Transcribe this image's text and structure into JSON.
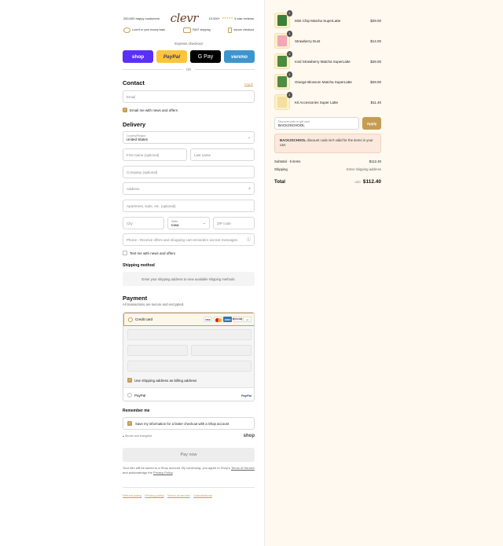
{
  "trust": {
    "customers": "250,000 happy customers",
    "brand": "clevr",
    "reviews_count": "10,000+",
    "stars": "★★★★★",
    "reviews_label": "5 star reviews",
    "badge_money_back": "Love it or your money back",
    "badge_shipping": "FAST shipping",
    "badge_secure": "secure checkout"
  },
  "express": {
    "label": "Express checkout",
    "shop": "shop",
    "paypal": "PayPal",
    "gpay": "G Pay",
    "venmo": "venmo",
    "or": "OR"
  },
  "contact": {
    "title": "Contact",
    "login": "Log in",
    "email_placeholder": "Email",
    "email_news": "Email me with news and offers"
  },
  "delivery": {
    "title": "Delivery",
    "country_label": "Country/Region",
    "country_value": "United States",
    "first_name": "First name (optional)",
    "last_name": "Last name",
    "company": "Company (optional)",
    "address": "Address",
    "apartment": "Apartment, suite, etc. (optional)",
    "city": "City",
    "state_label": "State",
    "state_value": "Iowa",
    "zip": "ZIP code",
    "phone": "Phone - Receive offers and shopping cart reminders via text messages",
    "text_news": "Text me with news and offers"
  },
  "shipping": {
    "title": "Shipping method",
    "notice": "Enter your shipping address to view available shipping methods."
  },
  "payment": {
    "title": "Payment",
    "note": "All transactions are secure and encrypted.",
    "credit_card": "Credit card",
    "card_visa": "VISA",
    "card_amex": "AMEX",
    "card_discover": "DISCOVER",
    "card_more": "+4",
    "billing_same": "Use shipping address as billing address",
    "paypal": "PayPal",
    "paypal_logo": "PayPal"
  },
  "remember": {
    "title": "Remember me",
    "save_info": "Save my information for a faster checkout with a Shop account",
    "secure": "Secure and encrypted",
    "shop": "shop"
  },
  "pay_now": "Pay now",
  "legal": {
    "line1": "Your info will be saved to a Shop account. By continuing, you agree to Shop's",
    "terms": "Terms of Service",
    "mid": " and acknowledge the ",
    "privacy": "Privacy Policy",
    "end": "."
  },
  "footer": {
    "refund": "Refund policy",
    "privacy": "Privacy policy",
    "terms": "Terms of service",
    "cancellations": "Cancellations"
  },
  "cart": {
    "items": [
      {
        "name": "Mint Chip Matcha SuperLatte",
        "price": "$29.00",
        "qty": "1",
        "color": "#3f7d3a"
      },
      {
        "name": "Strawberry Dust",
        "price": "$14.00",
        "qty": "1",
        "color": "#f2a7b6"
      },
      {
        "name": "Iced Strawberry Matcha SuperLatte",
        "price": "$29.00",
        "qty": "1",
        "color": "#4d8a3f"
      },
      {
        "name": "Orange Blossom Matcha SuperLatte",
        "price": "$29.00",
        "qty": "1",
        "color": "#4f8c43"
      },
      {
        "name": "Kit Accessories Super Latte",
        "price": "$11.40",
        "qty": "1",
        "color": "#f3dfa0"
      }
    ],
    "discount_label": "Discount code or gift card",
    "discount_value": "BACK2SCHOOL",
    "apply": "Apply",
    "error_code": "BACK2SCHOOL",
    "error_text": " discount code isn't valid for the items in your cart",
    "subtotal_label": "Subtotal · 5 items",
    "subtotal_value": "$112.40",
    "shipping_label": "Shipping",
    "shipping_value": "Enter shipping address",
    "total_label": "Total",
    "currency": "USD",
    "total_value": "$112.40"
  },
  "colors": {
    "accent": "#c69c54",
    "shop_purple": "#5a31f4",
    "paypal_yellow": "#ffc439",
    "venmo_blue": "#3d95ce",
    "summary_bg": "#fff9ef",
    "error_bg": "#fbe9dd"
  }
}
